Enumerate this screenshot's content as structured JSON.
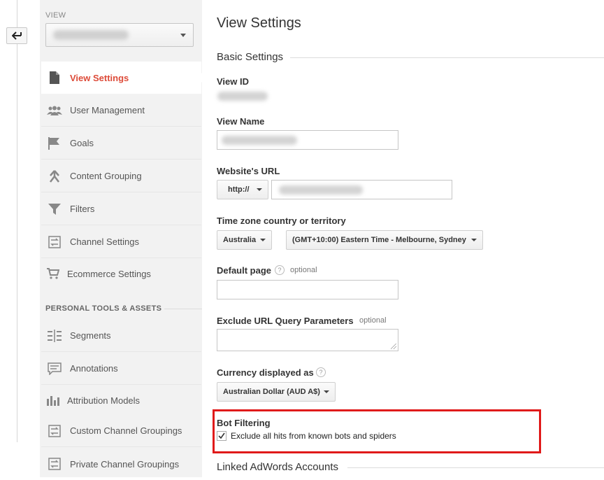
{
  "nav": {
    "view_label": "VIEW",
    "back_icon": "arrow-left-icon",
    "items": [
      {
        "label": "View Settings",
        "icon": "document-icon",
        "active": true
      },
      {
        "label": "User Management",
        "icon": "users-icon"
      },
      {
        "label": "Goals",
        "icon": "flag-icon"
      },
      {
        "label": "Content Grouping",
        "icon": "grouping-icon"
      },
      {
        "label": "Filters",
        "icon": "filter-icon"
      },
      {
        "label": "Channel Settings",
        "icon": "channel-icon"
      },
      {
        "label": "Ecommerce Settings",
        "icon": "cart-icon"
      }
    ],
    "section_heading": "PERSONAL TOOLS & ASSETS",
    "tools": [
      {
        "label": "Segments",
        "icon": "segments-icon"
      },
      {
        "label": "Annotations",
        "icon": "annotation-icon"
      },
      {
        "label": "Attribution Models",
        "icon": "bar-chart-icon"
      },
      {
        "label": "Custom Channel Groupings",
        "icon": "channel-icon"
      },
      {
        "label": "Private Channel Groupings",
        "icon": "channel-icon"
      }
    ]
  },
  "main": {
    "title": "View Settings",
    "basic_settings": "Basic Settings",
    "view_id_label": "View ID",
    "view_name_label": "View Name",
    "website_url_label": "Website's URL",
    "protocol": "http://",
    "timezone_label": "Time zone country or territory",
    "country": "Australia",
    "timezone": "(GMT+10:00) Eastern Time - Melbourne, Sydney",
    "default_page_label": "Default page",
    "optional": "optional",
    "exclude_params_label": "Exclude URL Query Parameters",
    "currency_label": "Currency displayed as",
    "currency": "Australian Dollar (AUD A$)",
    "bot_filtering_label": "Bot Filtering",
    "bot_filtering_checkbox": "Exclude all hits from known bots and spiders",
    "bot_filtering_checked": true,
    "linked_adwords": "Linked AdWords Accounts",
    "help_glyph": "?"
  },
  "colors": {
    "active": "#dd4b39",
    "highlight": "#e01a1a"
  }
}
